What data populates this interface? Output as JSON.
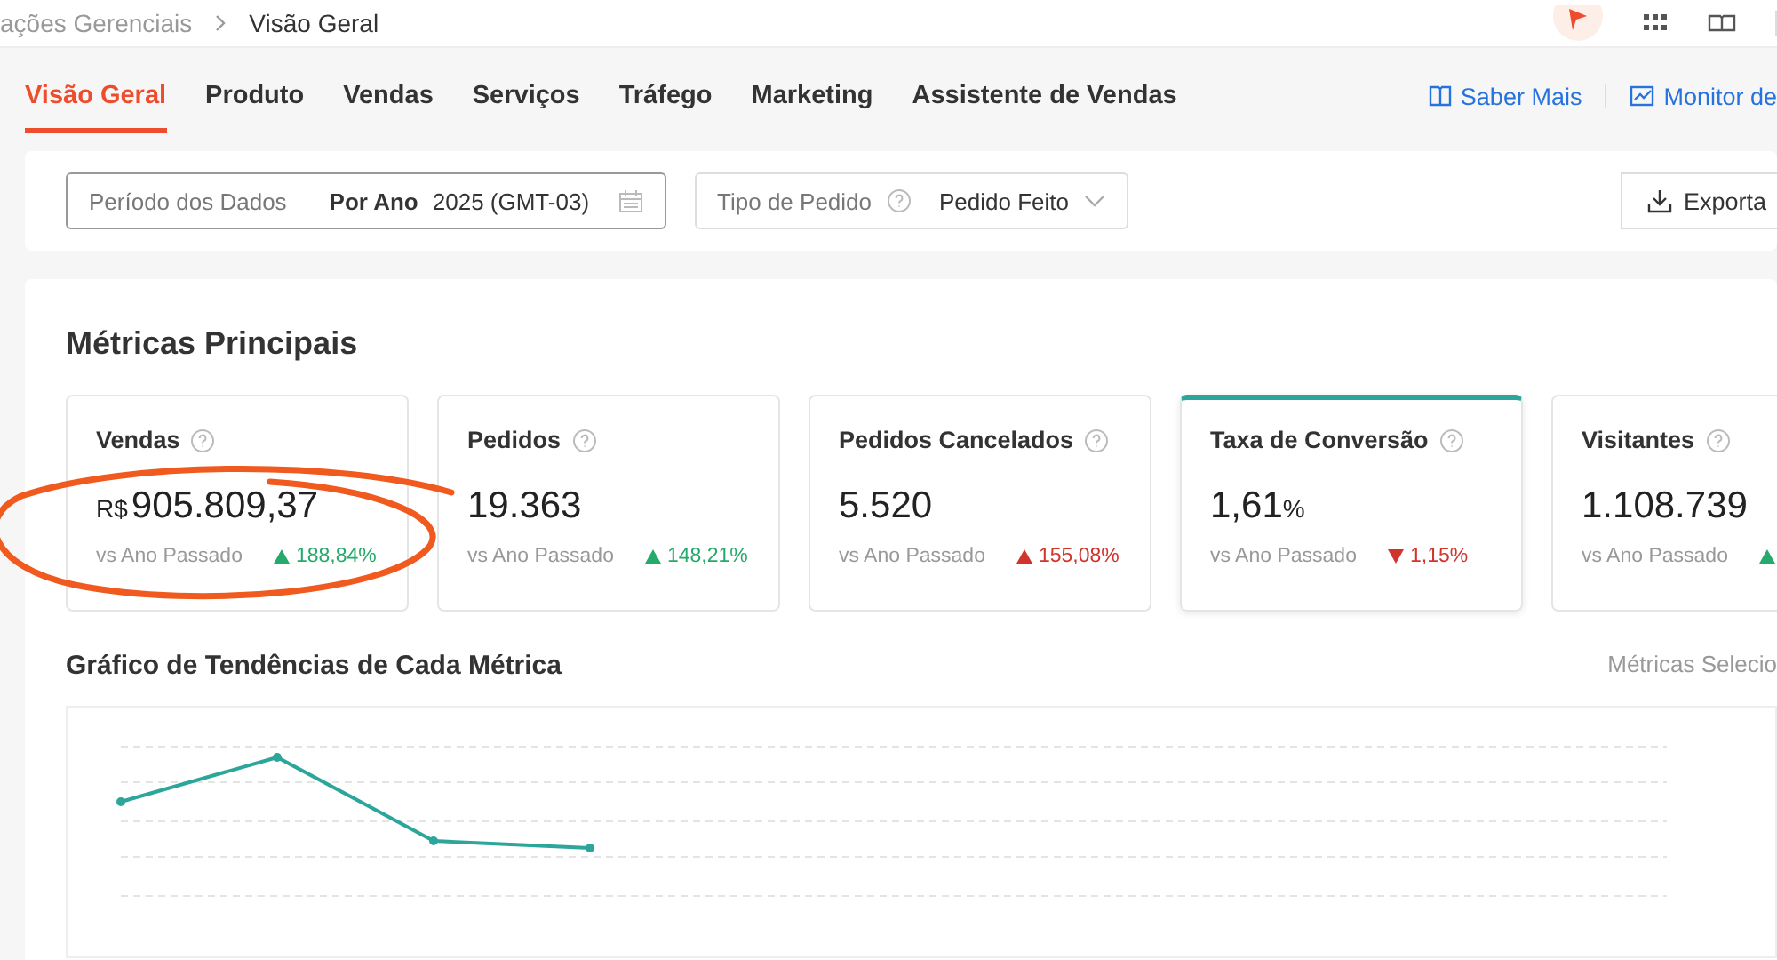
{
  "breadcrumb": [
    {
      "label": "ações Gerenciais",
      "current": false
    },
    {
      "label": "Visão Geral",
      "current": true
    }
  ],
  "tabs": [
    {
      "label": "Visão Geral",
      "selected": true
    },
    {
      "label": "Produto",
      "selected": false
    },
    {
      "label": "Vendas",
      "selected": false
    },
    {
      "label": "Serviços",
      "selected": false
    },
    {
      "label": "Tráfego",
      "selected": false
    },
    {
      "label": "Marketing",
      "selected": false
    },
    {
      "label": "Assistente de Vendas",
      "selected": false
    }
  ],
  "tab_links": [
    {
      "label": "Saber Mais",
      "kind": "book"
    },
    {
      "label": "Monitor de",
      "kind": "chart"
    }
  ],
  "filters": {
    "period_label": "Período dos Dados",
    "period_mode": "Por Ano",
    "period_value": "2025 (GMT-03)",
    "order_type_label": "Tipo de Pedido",
    "order_type_value": "Pedido Feito",
    "export_button": "Exporta"
  },
  "metrics_title": "Métricas Principais",
  "metrics": [
    {
      "name": "Vendas",
      "prefix": "R$",
      "value": "905.809,37",
      "compare": "vs Ano Passado",
      "change": "188,84%",
      "kind": "up",
      "positive": true,
      "selected": false,
      "circled": true
    },
    {
      "name": "Pedidos",
      "value": "19.363",
      "compare": "vs Ano Passado",
      "change": "148,21%",
      "kind": "up",
      "positive": true,
      "selected": false,
      "circled": false
    },
    {
      "name": "Pedidos Cancelados",
      "value": "5.520",
      "compare": "vs Ano Passado",
      "change": "155,08%",
      "kind": "up",
      "positive": false,
      "selected": false,
      "circled": false
    },
    {
      "name": "Taxa de Conversão",
      "value": "1,61",
      "suffix": "%",
      "compare": "vs Ano Passado",
      "change": "1,15%",
      "kind": "down",
      "positive": false,
      "selected": true,
      "circled": false
    },
    {
      "name": "Visitantes",
      "value": "1.108.739",
      "compare": "vs Ano Passado",
      "kind": "up",
      "positive": true,
      "selected": false,
      "circled": false
    }
  ],
  "trend_chart": {
    "title": "Gráfico de Tendências de Cada Métrica",
    "selector": "Métricas Selecio"
  }
}
